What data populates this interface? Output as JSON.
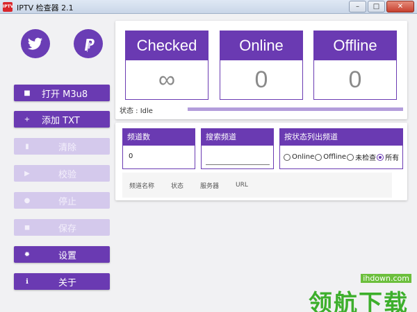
{
  "window": {
    "title": "IPTV 检查器 2.1",
    "app_icon_text": "IPTV",
    "minimize": "–",
    "maximize": "□",
    "close": "✕"
  },
  "social": {
    "twitter_icon": "twitter-bird-icon",
    "paypal_icon": "paypal-icon",
    "accent": "#6a3ab2"
  },
  "sidebar": {
    "buttons": [
      {
        "label": "打开 M3u8",
        "icon": "■",
        "enabled": true
      },
      {
        "label": "添加 TXT",
        "icon": "+",
        "enabled": true
      },
      {
        "label": "清除",
        "icon": "▮",
        "enabled": false
      },
      {
        "label": "校验",
        "icon": "▶",
        "enabled": false
      },
      {
        "label": "停止",
        "icon": "●",
        "enabled": false
      },
      {
        "label": "保存",
        "icon": "◼",
        "enabled": false
      },
      {
        "label": "设置",
        "icon": "✹",
        "enabled": true
      },
      {
        "label": "关于",
        "icon": "ℹ",
        "enabled": true
      }
    ]
  },
  "stats": {
    "checked_label": "Checked",
    "checked_value": "∞",
    "online_label": "Online",
    "online_value": "0",
    "offline_label": "Offline",
    "offline_value": "0"
  },
  "status": {
    "text": "状态 : Idle",
    "progress_percent": 100,
    "progress_color": "#b39ddb"
  },
  "filters": {
    "channel_count_label": "频道数",
    "channel_count_value": "0",
    "search_label": "搜索频道",
    "search_value": "",
    "filter_label": "按状态列出频道",
    "radio_options": [
      "Online",
      "Offline",
      "未检查",
      "所有"
    ],
    "selected_index": 3
  },
  "table": {
    "columns": [
      "频道名称",
      "状态",
      "服务器",
      "URL"
    ]
  },
  "watermark": {
    "url": "ihdown.com",
    "text": "领航下载"
  }
}
